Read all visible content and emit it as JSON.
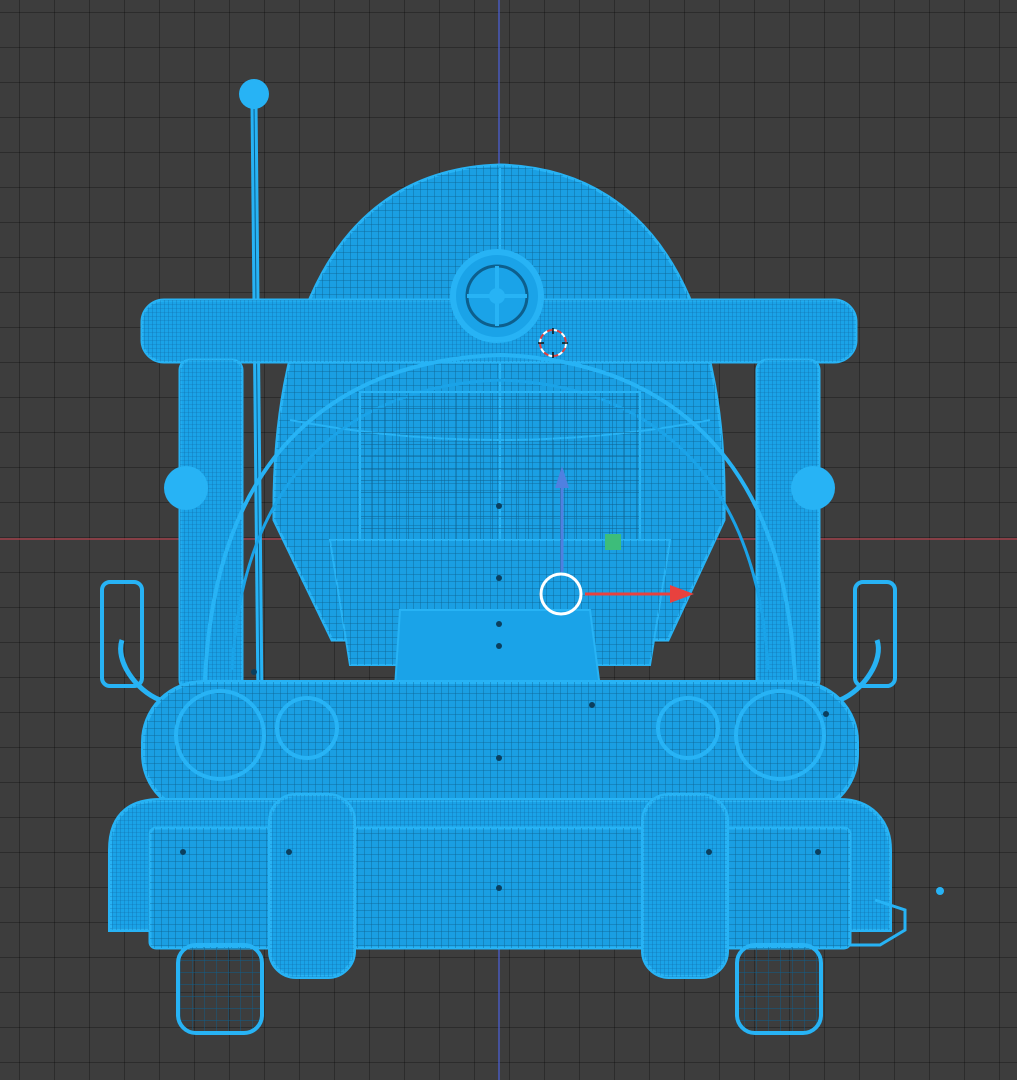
{
  "viewport": {
    "view": "front-orthographic",
    "shading": "wireframe",
    "background_color": "#3d3d3d",
    "grid_color": "#2b2b2b",
    "x_axis_color": "#b2414c",
    "z_axis_color": "#4a5ed1"
  },
  "object": {
    "name": "vehicle-model",
    "selected": true,
    "wire_color": "#1aa3e8",
    "selected_fill": "#27b3f5"
  },
  "gizmo": {
    "type": "translate",
    "x_handle_color": "#e8413e",
    "y_handle_color": "#5080e0",
    "plane_handle_color": "#3dbd7a",
    "center_ring_color": "#ffffff"
  },
  "cursor_3d": {
    "colors": [
      "#ffffff",
      "#e04040"
    ]
  }
}
